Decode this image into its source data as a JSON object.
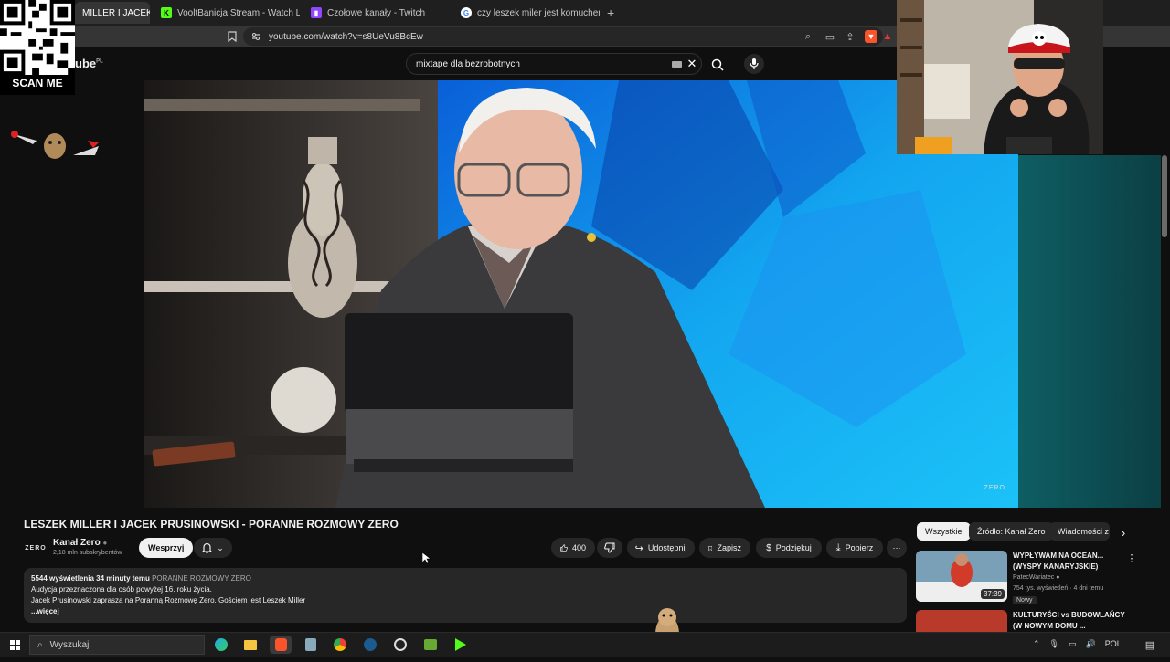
{
  "browser": {
    "tabs": [
      {
        "label": "MILLER I JACEK P...",
        "active": true,
        "icon": "youtube-icon"
      },
      {
        "label": "VooltBanicja Stream - Watch Live on",
        "active": false,
        "icon": "kick-icon"
      },
      {
        "label": "Czołowe kanały - Twitch",
        "active": false,
        "icon": "twitch-icon"
      },
      {
        "label": "czy leszek miler jest komuchem - Sz...",
        "active": false,
        "icon": "google-icon"
      }
    ],
    "url": "youtube.com/watch?v=s8UeVu8BcEw"
  },
  "overlay": {
    "scan_label": "SCAN ME",
    "yt_logo_text": "ube",
    "yt_region": "PL"
  },
  "search": {
    "query": "mixtape dla bezrobotnych"
  },
  "video": {
    "watermark": "ZERO"
  },
  "info": {
    "title": "LESZEK MILLER I JACEK PRUSINOWSKI - PORANNE ROZMOWY ZERO",
    "channel": "Kanał Zero",
    "subscribers": "2,18 mln subskrybentów",
    "support_label": "Wesprzyj",
    "like_count": "400",
    "share_label": "Udostępnij",
    "save_label": "Zapisz",
    "thanks_label": "Podziękuj",
    "download_label": "Pobierz",
    "desc": {
      "views": "5544 wyświetlenia",
      "time": "34 minuty temu",
      "tag": "PORANNE ROZMOWY ZERO",
      "line1": "Audycja przeznaczona dla osób powyżej 16. roku życia.",
      "line2": "Jacek Prusinowski zaprasza na Poranną Rozmowę Zero. Gościem jest Leszek Miller",
      "more": "...więcej"
    }
  },
  "sidebar": {
    "chips": [
      "Wszystkie",
      "Źródło: Kanał Zero",
      "Wiadomości z"
    ],
    "videos": [
      {
        "title1": "WYPŁYWAM NA OCEAN...",
        "title2": "(WYSPY KANARYJSKIE)",
        "channel": "PatecWariatec",
        "meta": "754 tys. wyświetleń · 4 dni temu",
        "badge": "Nowy",
        "duration": "37:39"
      },
      {
        "title1": "KULTURYŚCI vs BUDOWLAŃCY",
        "title2": "(W NOWYM DOMU ...",
        "channel": "",
        "meta": "",
        "badge": "",
        "duration": ""
      }
    ]
  },
  "taskbar": {
    "search_placeholder": "Wyszukaj",
    "lang": "POL"
  }
}
